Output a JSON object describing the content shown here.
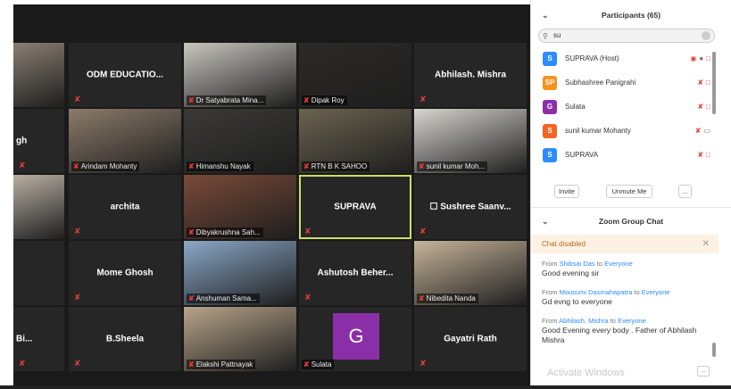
{
  "gallery": {
    "rows": [
      [
        {
          "type": "photo",
          "label": "",
          "bg": "#8a7f73"
        },
        {
          "type": "name",
          "name": "ODM EDUCATIO..."
        },
        {
          "type": "photo",
          "label": "Dr Satyabrata Mina...",
          "bg": "#c9c6c0"
        },
        {
          "type": "photo",
          "label": "Dipak Roy",
          "bg": "#2c2a28"
        },
        {
          "type": "name",
          "name": "Abhilash. Mishra"
        }
      ],
      [
        {
          "type": "name",
          "name": "gh",
          "partial": true
        },
        {
          "type": "photo",
          "label": "Arindam Mohanty",
          "bg": "#8c7b6a"
        },
        {
          "type": "photo",
          "label": "Himanshu Nayak",
          "bg": "#3b3a36"
        },
        {
          "type": "photo",
          "label": "RTN B K SAHOO",
          "bg": "#6b6350"
        },
        {
          "type": "photo",
          "label": "sunil kumar Moh...",
          "bg": "#d8d4cf"
        }
      ],
      [
        {
          "type": "photo",
          "label": "",
          "bg": "#b9b0a4"
        },
        {
          "type": "name",
          "name": "archita"
        },
        {
          "type": "photo",
          "label": "Dibyakrushna Sah...",
          "bg": "#7a4a38"
        },
        {
          "type": "name",
          "name": "SUPRAVA",
          "active": true
        },
        {
          "type": "name",
          "name": "☐ Sushree  Saanv..."
        }
      ],
      [
        {
          "type": "blank"
        },
        {
          "type": "name",
          "name": "Mome Ghosh"
        },
        {
          "type": "photo",
          "label": "Anshuman Sama...",
          "bg": "#8aa8c8"
        },
        {
          "type": "name",
          "name": "Ashutosh  Beher..."
        },
        {
          "type": "photo",
          "label": "Nibedita Nanda",
          "bg": "#c7b49a"
        }
      ],
      [
        {
          "type": "name",
          "name": "Bi...",
          "partial": true
        },
        {
          "type": "name",
          "name": "B.Sheela"
        },
        {
          "type": "photo",
          "label": "Elakshi Pattnayak",
          "bg": "#b8a48a"
        },
        {
          "type": "avatar",
          "label": "Sulata",
          "letter": "G",
          "bg": "#8b2fa8"
        },
        {
          "type": "name",
          "name": "Gayatri Rath"
        }
      ]
    ]
  },
  "participants": {
    "header": "Participants (65)",
    "search_value": "su",
    "list": [
      {
        "initials": "S",
        "color": "#2d8cff",
        "name": "SUPRAVA (Host)",
        "icons": "host"
      },
      {
        "initials": "SP",
        "color": "#f7931e",
        "name": "Subhashree Panigrahi",
        "icons": "muted"
      },
      {
        "initials": "G",
        "color": "#8b2fa8",
        "name": "Sulata",
        "icons": "muted"
      },
      {
        "initials": "S",
        "color": "#f26522",
        "name": "sunil kumar Mohanty",
        "icons": "mutedvideo"
      },
      {
        "initials": "S",
        "color": "#2d8cff",
        "name": "SUPRAVA",
        "icons": "muted"
      }
    ],
    "invite_label": "Invite",
    "unmute_label": "Unmute Me",
    "more_label": "..."
  },
  "chat": {
    "header": "Zoom Group Chat",
    "disabled_text": "Chat disabled",
    "messages": [
      {
        "from_prefix": "From ",
        "sender": "Shibsai Das",
        "to_word": " to ",
        "recipient": "Everyone",
        "text": "Good evening sir"
      },
      {
        "from_prefix": "From ",
        "sender": "Mousumi Dasmahapatra",
        "to_word": " to ",
        "recipient": "Everyone",
        "text": "Gd evng to everyone"
      },
      {
        "from_prefix": "From ",
        "sender": "Abhilash. Mishra",
        "to_word": " to ",
        "recipient": "Everyone",
        "text": "Good Evening every body . Father of Abhilash Mishra"
      }
    ],
    "watermark": "Activate Windows",
    "more": "..."
  }
}
